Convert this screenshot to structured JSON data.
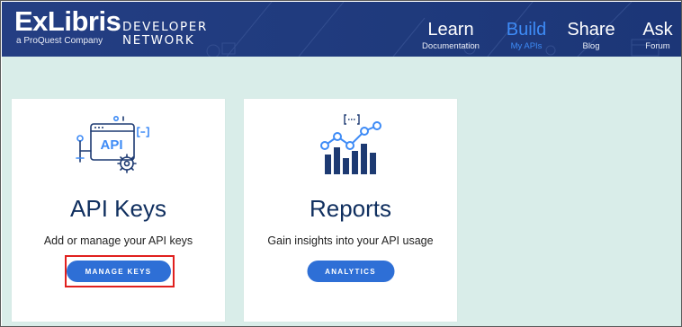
{
  "header": {
    "logo_text": "ExLibris",
    "logo_subtitle": "a ProQuest Company",
    "network_line1": "DEVELOPER",
    "network_line2": "NETWORK",
    "nav": [
      {
        "title": "Learn",
        "subtitle": "Documentation",
        "active": false
      },
      {
        "title": "Build",
        "subtitle": "My APIs",
        "active": true
      },
      {
        "title": "Share",
        "subtitle": "Blog",
        "active": false
      },
      {
        "title": "Ask",
        "subtitle": "Forum",
        "active": false
      }
    ]
  },
  "cards": [
    {
      "title": "API Keys",
      "description": "Add or manage your API keys",
      "button_label": "MANAGE KEYS",
      "icon": "api-keys-icon",
      "icon_text": "API",
      "highlighted": true
    },
    {
      "title": "Reports",
      "description": "Gain insights into your API usage",
      "button_label": "ANALYTICS",
      "icon": "reports-chart-icon",
      "highlighted": false
    }
  ],
  "colors": {
    "header_bg": "#203b7e",
    "active_nav": "#3e8bf6",
    "content_bg": "#d9ede9",
    "button_bg": "#2e6fd6",
    "title_text": "#102f5f",
    "highlight": "#e0201e"
  }
}
